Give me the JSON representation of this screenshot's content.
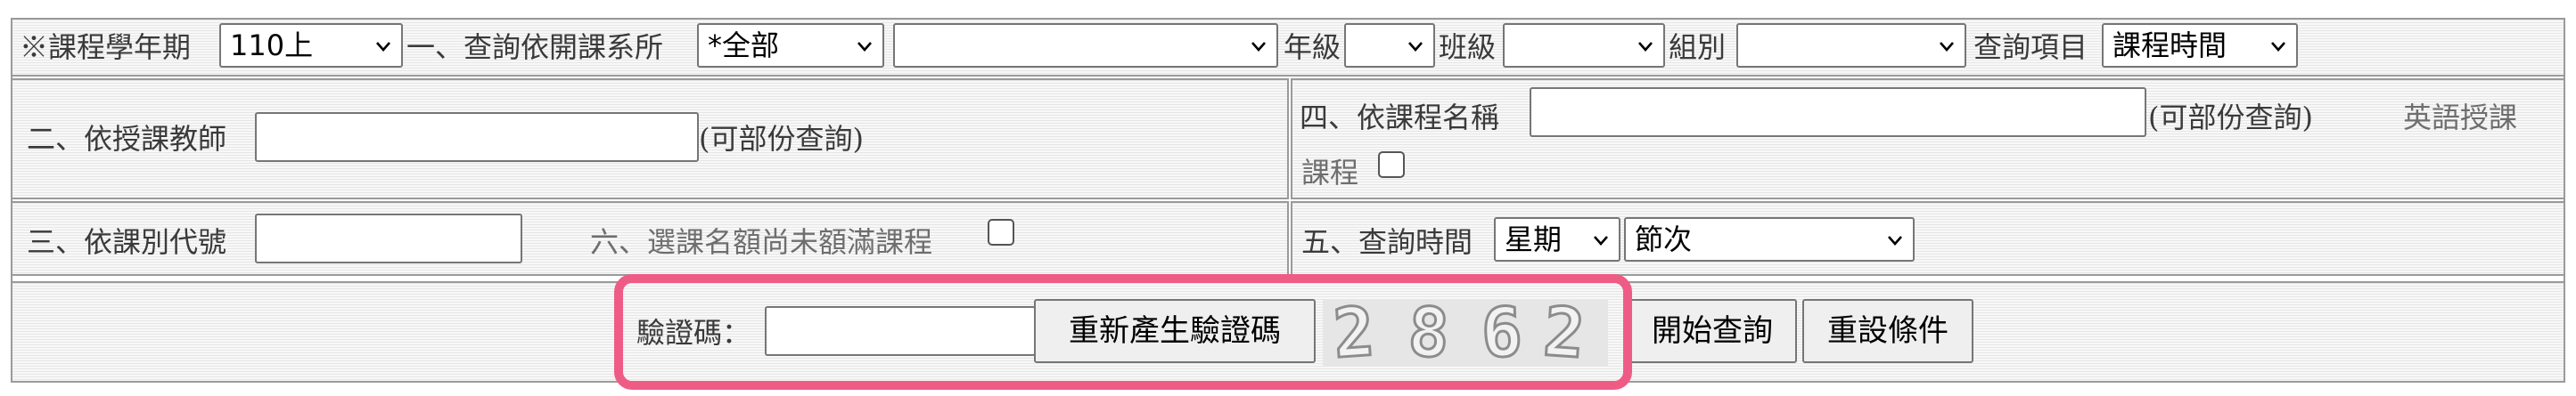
{
  "row1": {
    "term_label": "※課程學年期",
    "term_value": "110上",
    "dept_label": "一、查詢依開課系所",
    "dept_value": "*全部",
    "dept_sub_value": "",
    "grade_label": "年級",
    "grade_value": "",
    "class_label": "班級",
    "class_value": "",
    "group_label": "組別",
    "group_value": "",
    "query_item_label": "查詢項目",
    "query_item_value": "課程時間"
  },
  "row2": {
    "teacher_label": "二、依授課教師",
    "teacher_value": "",
    "teacher_hint": "(可部份查詢)",
    "course_name_label": "四、依課程名稱",
    "course_name_value": "",
    "course_name_hint": "(可部份查詢)",
    "english_label_line1": "英語授課",
    "english_label_line2": "課程"
  },
  "row3": {
    "category_label": "三、依課別代號",
    "category_value": "",
    "unfilled_label": "六、選課名額尚未額滿課程",
    "time_label": "五、查詢時間",
    "weekday_value": "星期",
    "period_value": "節次"
  },
  "row4": {
    "captcha_label": "驗證碼：",
    "captcha_input_value": "",
    "regenerate_button": "重新產生驗證碼",
    "captcha_digits": [
      "2",
      "8",
      "6",
      "2"
    ],
    "search_button": "開始查詢",
    "reset_button": "重設條件"
  },
  "colors": {
    "highlight": "#ee5c86",
    "border": "#9a9a9a"
  }
}
